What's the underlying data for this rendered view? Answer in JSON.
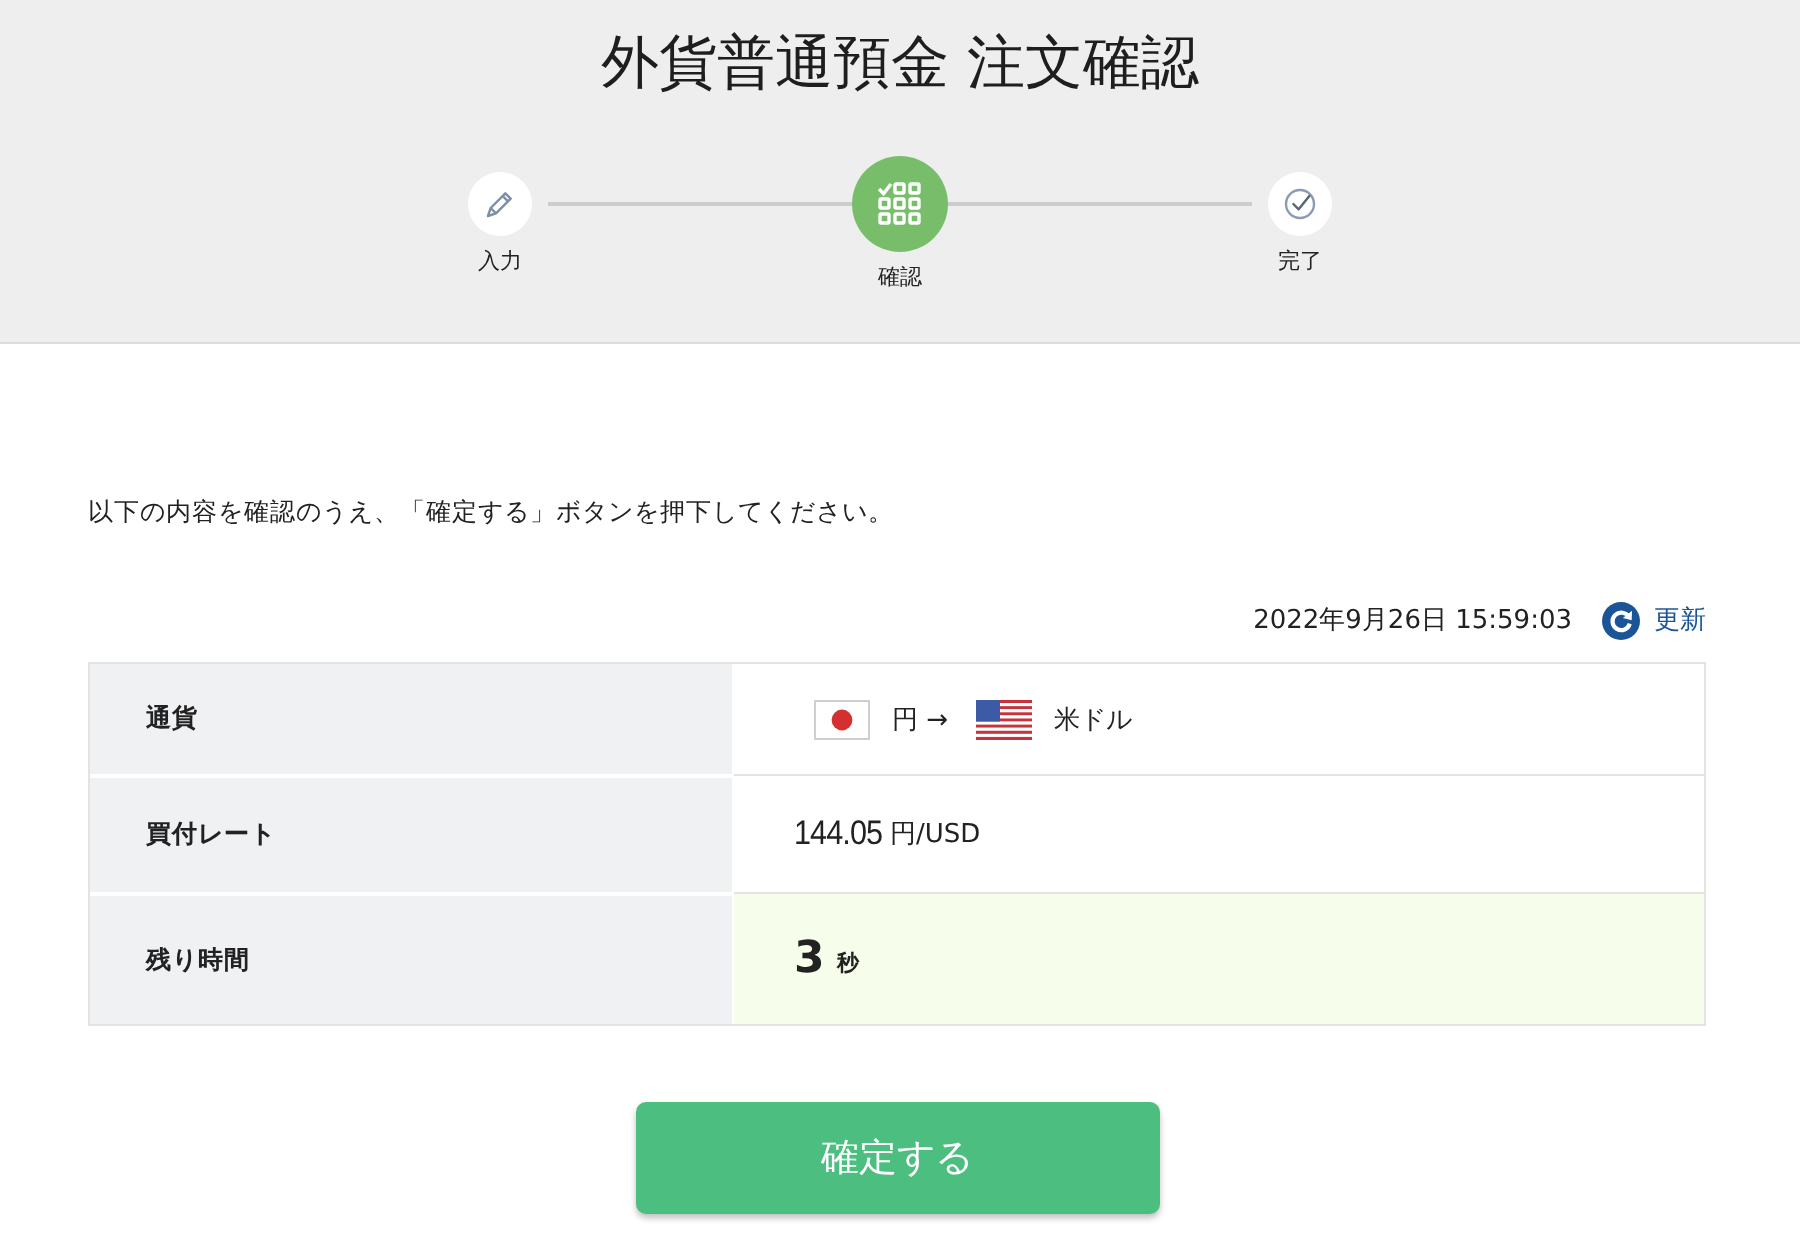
{
  "page": {
    "title": "外貨普通預金 注文確認"
  },
  "steps": [
    {
      "label": "入力",
      "kind": "edit",
      "selected": false
    },
    {
      "label": "確認",
      "kind": "confirm",
      "selected": true
    },
    {
      "label": "完了",
      "kind": "done",
      "selected": false
    }
  ],
  "instruction": "以下の内容を確認のうえ、「確定する」ボタンを押下してください。",
  "timestamp": "2022年9月26日 15:59:03",
  "refresh_link": "更新",
  "table": {
    "rows": [
      {
        "kind": "currency",
        "label": "通貨",
        "from": "円 →",
        "to": "米ドル"
      },
      {
        "kind": "rate",
        "label": "買付レート",
        "value": "144.05",
        "unit": "円/USD"
      },
      {
        "kind": "countdown",
        "label": "残り時間",
        "value": "3",
        "unit": "秒"
      }
    ]
  },
  "confirm_button": "確定する"
}
